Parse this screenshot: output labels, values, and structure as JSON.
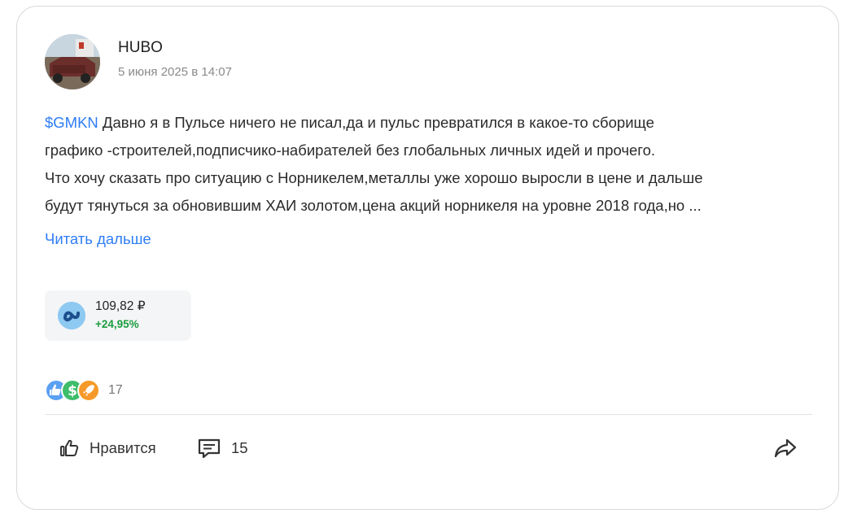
{
  "post": {
    "author": "HUBO",
    "date": "5 июня 2025 в 14:07",
    "ticker": "$GMKN",
    "lines": [
      " Давно я в Пульсе ничего не писал,да и пульс превратился в какое-то сборище",
      "графико -строителей,подписчико-набирателей без глобальных личных идей и прочего.",
      "Что хочу сказать про ситуацию с Норникелем,металлы уже хорошо выросли в цене и дальше",
      "будут тянуться за обновившим ХАИ золотом,цена акций норникеля на уровне 2018 года,но ..."
    ],
    "read_more": "Читать дальше"
  },
  "stock": {
    "price": "109,82 ₽",
    "change": "+24,95%",
    "logo_icon": "nornickel-logo-icon",
    "change_color": "#1a9c3e"
  },
  "reactions": {
    "icons": [
      "like-reaction-icon",
      "dollar-reaction-icon",
      "rocket-reaction-icon"
    ],
    "count": "17"
  },
  "actions": {
    "like_label": "Нравится",
    "comments_count": "15"
  },
  "colors": {
    "accent": "#2f7df6",
    "positive": "#1a9c3e"
  }
}
